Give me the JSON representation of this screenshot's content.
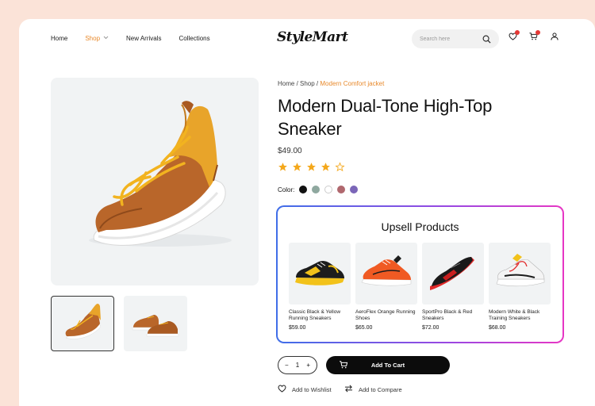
{
  "header": {
    "nav": [
      {
        "label": "Home"
      },
      {
        "label": "Shop"
      },
      {
        "label": "New Arrivals"
      },
      {
        "label": "Collections"
      }
    ],
    "logo": "StyleMart",
    "search_placeholder": "Search here",
    "icons": [
      "search-icon",
      "heart-icon",
      "cart-icon",
      "user-icon"
    ],
    "badge_color": "#e53935"
  },
  "breadcrumb": {
    "home": "Home",
    "shop": "Shop",
    "current": "Modern Comfort jacket"
  },
  "product": {
    "title": "Modern Dual-Tone High-Top Sneaker",
    "price": "$49.00",
    "rating": 4,
    "rating_max": 5,
    "color_label": "Color:",
    "colors": [
      "#111111",
      "#8fa89f",
      "#ffffff",
      "#b0686e",
      "#7b66b8"
    ]
  },
  "upsell": {
    "title": "Upsell Products",
    "items": [
      {
        "name": "Classic Black & Yellow Running Sneakers",
        "price": "$59.00"
      },
      {
        "name": "AeroFlex Orange Running Shoes",
        "price": "$65.00"
      },
      {
        "name": "SportPro Black & Red Sneakers",
        "price": "$72.00"
      },
      {
        "name": "Modern White & Black Training Sneakers",
        "price": "$68.00"
      }
    ]
  },
  "actions": {
    "qty_minus": "−",
    "qty_value": "1",
    "qty_plus": "+",
    "add_to_cart": "Add To Cart",
    "wishlist": "Add to Wishlist",
    "compare": "Add to Compare"
  },
  "accent_color": "#e8892b"
}
